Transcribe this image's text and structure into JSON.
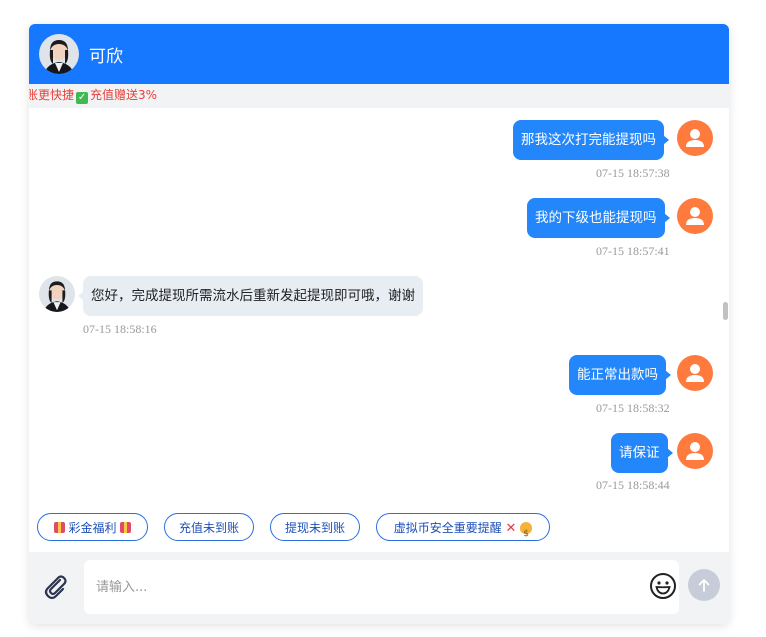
{
  "header": {
    "title": "可欣"
  },
  "notice": {
    "text_before": "账更快捷",
    "text_after": "充值赠送3%"
  },
  "messages": [
    {
      "side": "out",
      "text": "那我这次打完能提现吗",
      "time": "07-15 18:57:38"
    },
    {
      "side": "out",
      "text": "我的下级也能提现吗",
      "time": "07-15 18:57:41"
    },
    {
      "side": "in",
      "text": "您好，完成提现所需流水后重新发起提现即可哦，谢谢",
      "time": "07-15 18:58:16"
    },
    {
      "side": "out",
      "text": "能正常出款吗",
      "time": "07-15 18:58:32"
    },
    {
      "side": "out",
      "text": "请保证",
      "time": "07-15 18:58:44"
    }
  ],
  "quick_replies": [
    "彩金福利",
    "充值未到账",
    "提现未到账",
    "虚拟币安全重要提醒"
  ],
  "input": {
    "placeholder": "请输入..."
  },
  "colors": {
    "header": "#1677ff",
    "bubble_out": "#2387fb",
    "user_avatar": "#ff7a3d"
  }
}
